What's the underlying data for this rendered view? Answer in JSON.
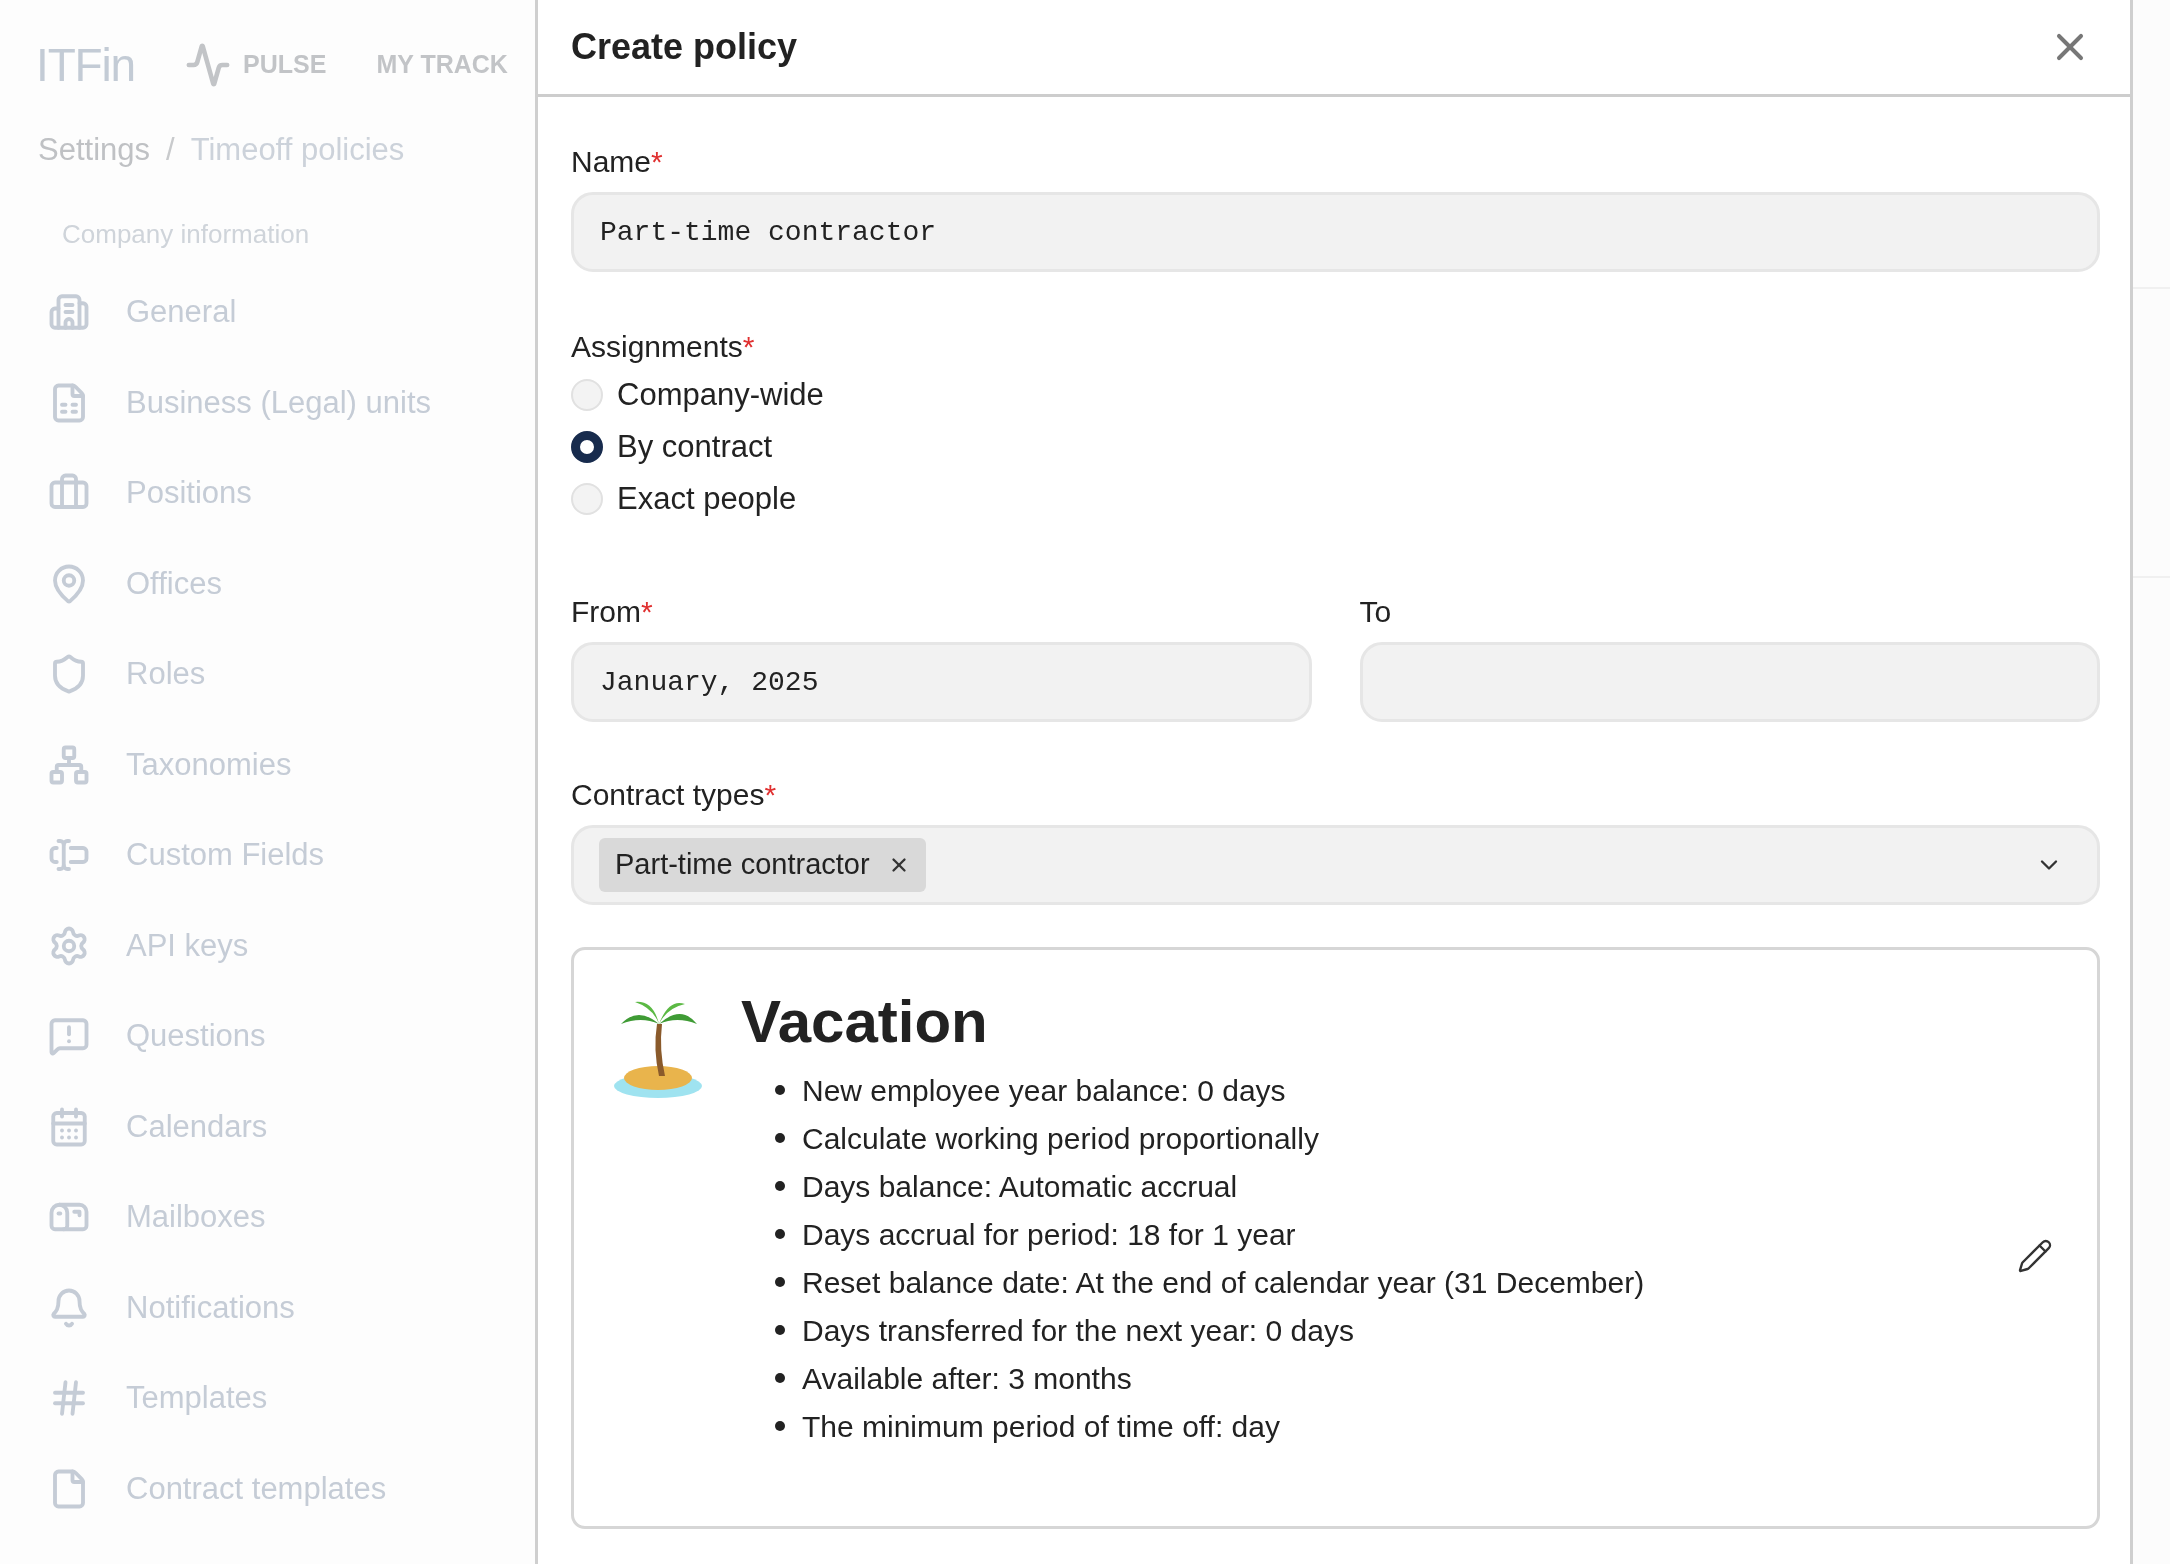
{
  "header": {
    "logo": "ITFin",
    "nav": [
      {
        "label": "PULSE",
        "kind": "pulse"
      },
      {
        "label": "MY TRACK",
        "kind": "plain"
      }
    ]
  },
  "breadcrumb": {
    "items": [
      "Settings",
      "Timeoff policies"
    ],
    "separator": "/"
  },
  "sidebar": {
    "section": "Company information",
    "items": [
      {
        "label": "General",
        "kind": "building"
      },
      {
        "label": "Business (Legal) units",
        "kind": "document"
      },
      {
        "label": "Positions",
        "kind": "briefcase"
      },
      {
        "label": "Offices",
        "kind": "pin"
      },
      {
        "label": "Roles",
        "kind": "shield"
      },
      {
        "label": "Taxonomies",
        "kind": "hierarchy"
      },
      {
        "label": "Custom Fields",
        "kind": "textfield"
      },
      {
        "label": "API keys",
        "kind": "gear"
      },
      {
        "label": "Questions",
        "kind": "chat"
      },
      {
        "label": "Calendars",
        "kind": "calendar"
      },
      {
        "label": "Mailboxes",
        "kind": "mailbox"
      },
      {
        "label": "Notifications",
        "kind": "bell"
      },
      {
        "label": "Templates",
        "kind": "hash"
      },
      {
        "label": "Contract templates",
        "kind": "file"
      }
    ]
  },
  "modal": {
    "title": "Create policy",
    "name": {
      "label": "Name",
      "mark": "*",
      "value": "Part-time contractor"
    },
    "assignments": {
      "label": "Assignments",
      "mark": "*",
      "options": [
        {
          "label": "Company-wide",
          "selected": false
        },
        {
          "label": "By contract",
          "selected": true
        },
        {
          "label": "Exact people",
          "selected": false
        }
      ]
    },
    "from": {
      "label": "From",
      "mark": "*",
      "value": "January, 2025"
    },
    "to": {
      "label": "To"
    },
    "contract_types": {
      "label": "Contract types",
      "mark": "*",
      "chips": [
        "Part-time contractor"
      ]
    },
    "policy_card": {
      "title": "Vacation",
      "rules": [
        "New employee year balance: 0 days",
        "Calculate working period proportionally",
        "Days balance: Automatic accrual",
        "Days accrual for period: 18 for 1 year",
        "Reset balance date: At the end of calendar year (31 December)",
        "Days transferred for the next year: 0 days",
        "Available after: 3 months",
        "The minimum period of time off: day"
      ]
    }
  }
}
